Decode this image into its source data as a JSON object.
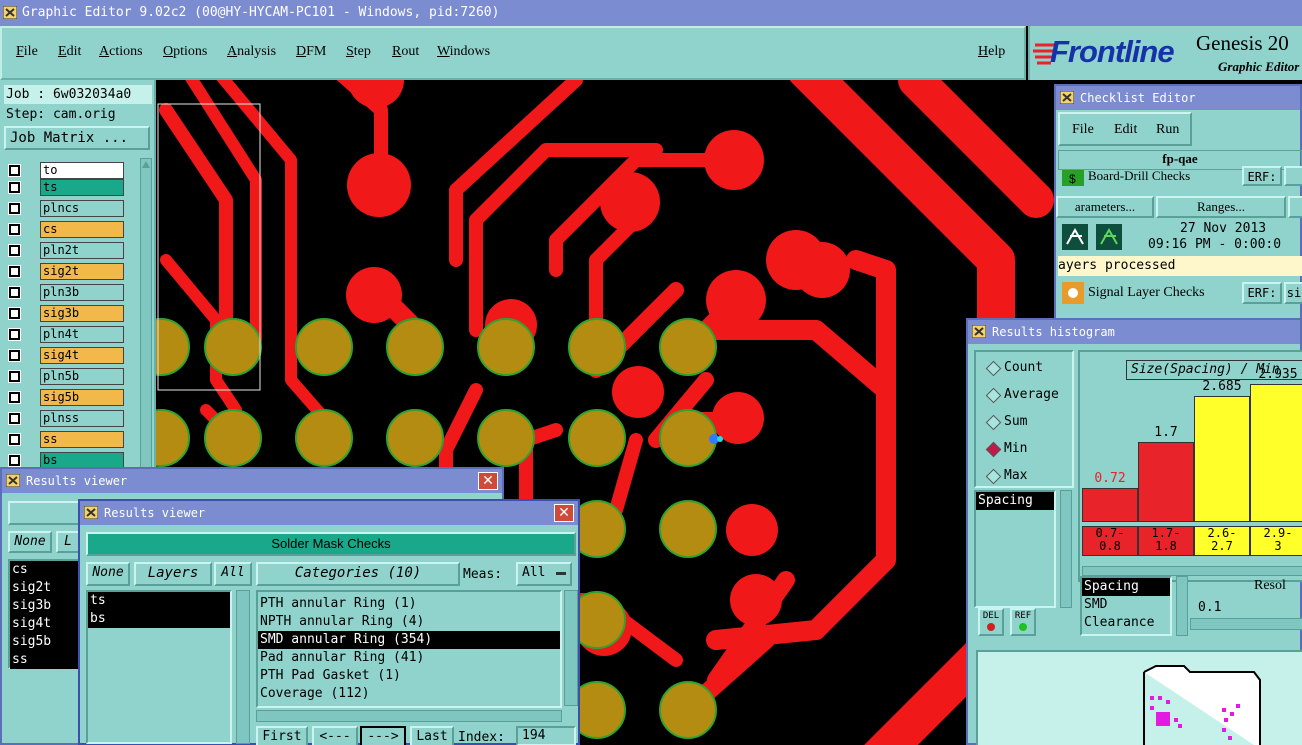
{
  "app": {
    "title": "Graphic Editor 9.02c2 (00@HY-HYCAM-PC101 - Windows, pid:7260)"
  },
  "menu": [
    "File",
    "Edit",
    "Actions",
    "Options",
    "Analysis",
    "DFM",
    "Step",
    "Rout",
    "Windows"
  ],
  "help_label": "Help",
  "logo": {
    "brand": "Frontline",
    "product": "Genesis 20",
    "subtitle": "Graphic Editor"
  },
  "job": {
    "job_line": "Job : 6w032034a0",
    "step_line": "Step: cam.orig",
    "matrix_button": "Job Matrix ..."
  },
  "layers": [
    {
      "name": "to",
      "color": "#ffffff"
    },
    {
      "name": "ts",
      "color": "#19a88a"
    },
    {
      "name": "plncs",
      "color": "#8fd3cc"
    },
    {
      "name": "cs",
      "color": "#f2b84a"
    },
    {
      "name": "pln2t",
      "color": "#8fd3cc"
    },
    {
      "name": "sig2t",
      "color": "#f2b84a"
    },
    {
      "name": "pln3b",
      "color": "#8fd3cc"
    },
    {
      "name": "sig3b",
      "color": "#f2b84a"
    },
    {
      "name": "pln4t",
      "color": "#8fd3cc"
    },
    {
      "name": "sig4t",
      "color": "#f2b84a"
    },
    {
      "name": "pln5b",
      "color": "#8fd3cc"
    },
    {
      "name": "sig5b",
      "color": "#f2b84a"
    },
    {
      "name": "plnss",
      "color": "#8fd3cc"
    },
    {
      "name": "ss",
      "color": "#f2b84a"
    },
    {
      "name": "bs",
      "color": "#19a88a"
    }
  ],
  "results_viewer_back": {
    "title": "Results viewer",
    "none_btn": "None",
    "layers_btn": "L",
    "items": [
      "cs",
      "sig2t",
      "sig3b",
      "sig4t",
      "sig5b",
      "ss"
    ]
  },
  "results_viewer": {
    "title": "Results viewer",
    "header": "Solder Mask Checks",
    "none_btn": "None",
    "layers_btn": "Layers",
    "all_btn": "All",
    "layers": [
      "ts",
      "bs"
    ],
    "categories_btn": "Categories (10)",
    "meas_label": "Meas:",
    "meas_value": "All",
    "categories": [
      "PTH annular Ring (1)",
      "NPTH annular Ring (4)",
      "SMD annular Ring (354)",
      "Pad annular Ring (41)",
      "PTH Pad Gasket (1)",
      "Coverage (112)"
    ],
    "selected_index": 2,
    "first_btn": "First",
    "prev_btn": "<---",
    "next_btn": "--->",
    "last_btn": "Last",
    "index_label": "Index:",
    "index_value": "194"
  },
  "checklist": {
    "title": "Checklist Editor",
    "menu": [
      "File",
      "Edit",
      "Run"
    ],
    "name": "fp-qae",
    "row1_label": "Board-Drill Checks",
    "erf_label": "ERF:",
    "parameters_btn": "arameters...",
    "ranges_btn": "Ranges...",
    "date": "27 Nov 2013",
    "time": "09:16 PM - 0:00:0",
    "status": "ayers processed",
    "row2_label": "Signal Layer Checks",
    "erf2_value": "si"
  },
  "histogram": {
    "title": "Results histogram",
    "modes": [
      "Count",
      "Average",
      "Sum",
      "Min",
      "Max"
    ],
    "selected_mode": "Min",
    "heading": "Size(Spacing) / Min",
    "list_items": [
      "Spacing"
    ],
    "del_btn": "DEL",
    "ref_btn": "REF",
    "bottom_list": [
      "Spacing",
      "SMD",
      "Clearance"
    ],
    "resol_label": "Resol",
    "resol_value": "0.1",
    "colors": {
      "low": "#e8232a",
      "high": "#ffff2a"
    }
  },
  "chart_data": {
    "type": "bar",
    "title": "Size(Spacing) / Min",
    "categories": [
      "0.7-0.8",
      "1.7-1.8",
      "2.6-2.7",
      "2.9-3"
    ],
    "category_lines": [
      [
        "0.7-",
        "0.8"
      ],
      [
        "1.7-",
        "1.8"
      ],
      [
        "2.6-",
        "2.7"
      ],
      [
        "2.9-",
        "3"
      ]
    ],
    "values": [
      0.72,
      1.7,
      2.685,
      2.935
    ],
    "value_labels": [
      "0.72",
      "1.7",
      "2.685",
      "2.935"
    ],
    "bar_colors": [
      "#e8232a",
      "#e8232a",
      "#ffff2a",
      "#ffff2a"
    ],
    "ylim": [
      0,
      3.2
    ]
  }
}
